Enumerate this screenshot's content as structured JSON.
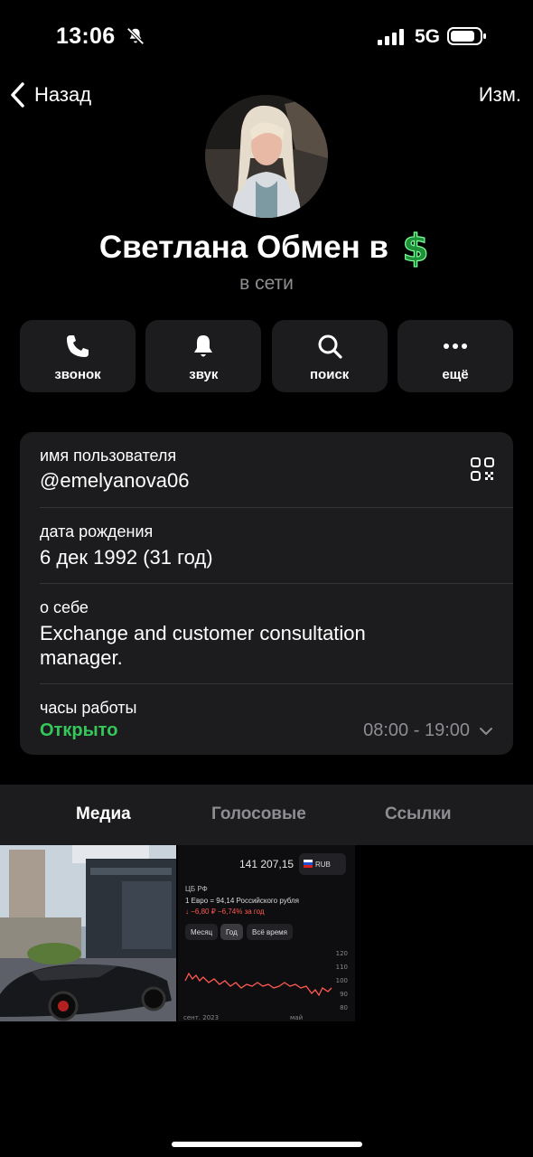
{
  "status_bar": {
    "time": "13:06",
    "network": "5G"
  },
  "nav": {
    "back_label": "Назад",
    "edit_label": "Изм."
  },
  "profile": {
    "name": "Светлана Обмен в",
    "status": "в сети"
  },
  "actions": [
    {
      "label": "звонок",
      "icon": "phone-icon"
    },
    {
      "label": "звук",
      "icon": "bell-icon"
    },
    {
      "label": "поиск",
      "icon": "search-icon"
    },
    {
      "label": "ещё",
      "icon": "more-icon"
    }
  ],
  "info": {
    "username_label": "имя пользователя",
    "username": "@emelyanova06",
    "birthday_label": "дата рождения",
    "birthday": "6 дек 1992 (31 год)",
    "about_label": "о себе",
    "about": "Exchange and customer consultation manager.",
    "hours_label": "часы работы",
    "hours_status": "Открыто",
    "hours_range": "08:00 - 19:00"
  },
  "tabs": [
    {
      "label": "Медиа",
      "active": true
    },
    {
      "label": "Голосовые",
      "active": false
    },
    {
      "label": "Ссылки",
      "active": false
    }
  ],
  "media": {
    "rate_amount": "141 207,15",
    "currency": "RUB",
    "source": "ЦБ РФ",
    "rate_line": "1 Евро = 94,14 Российского рубля",
    "change_line": "↓ −6,80 ₽ −6,74% за год",
    "period_buttons": [
      "Месяц",
      "Год",
      "Всё время"
    ],
    "axis_ticks": [
      "120",
      "110",
      "100",
      "90",
      "80"
    ],
    "axis_bottom_left": "сент. 2023",
    "axis_bottom_right": "май"
  },
  "colors": {
    "background": "#000000",
    "card": "#1c1c1e",
    "secondary_text": "#8d8d92",
    "open_green": "#34c759"
  }
}
